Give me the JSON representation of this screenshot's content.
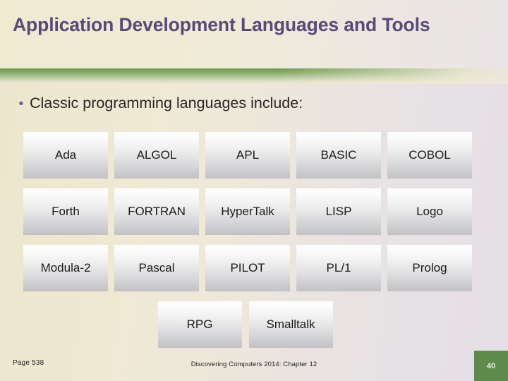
{
  "slide": {
    "title": "Application Development Languages and Tools",
    "accent_purple": "#564a78",
    "accent_green": "#5e8a4b",
    "background_left": "#ece6cd",
    "background_right": "#e5e0e6"
  },
  "body": {
    "bullet_glyph": "•",
    "bullet_text": "Classic programming languages include:"
  },
  "table": {
    "rows": [
      [
        "Ada",
        "ALGOL",
        "APL",
        "BASIC",
        "COBOL"
      ],
      [
        "Forth",
        "FORTRAN",
        "HyperTalk",
        "LISP",
        "Logo"
      ],
      [
        "Modula-2",
        "Pascal",
        "PILOT",
        "PL/1",
        "Prolog"
      ],
      [
        "RPG",
        "Smalltalk"
      ]
    ]
  },
  "footer": {
    "page_reference": "Page 538",
    "source": "Discovering Computers 2014: Chapter 12",
    "slide_number": "40"
  }
}
